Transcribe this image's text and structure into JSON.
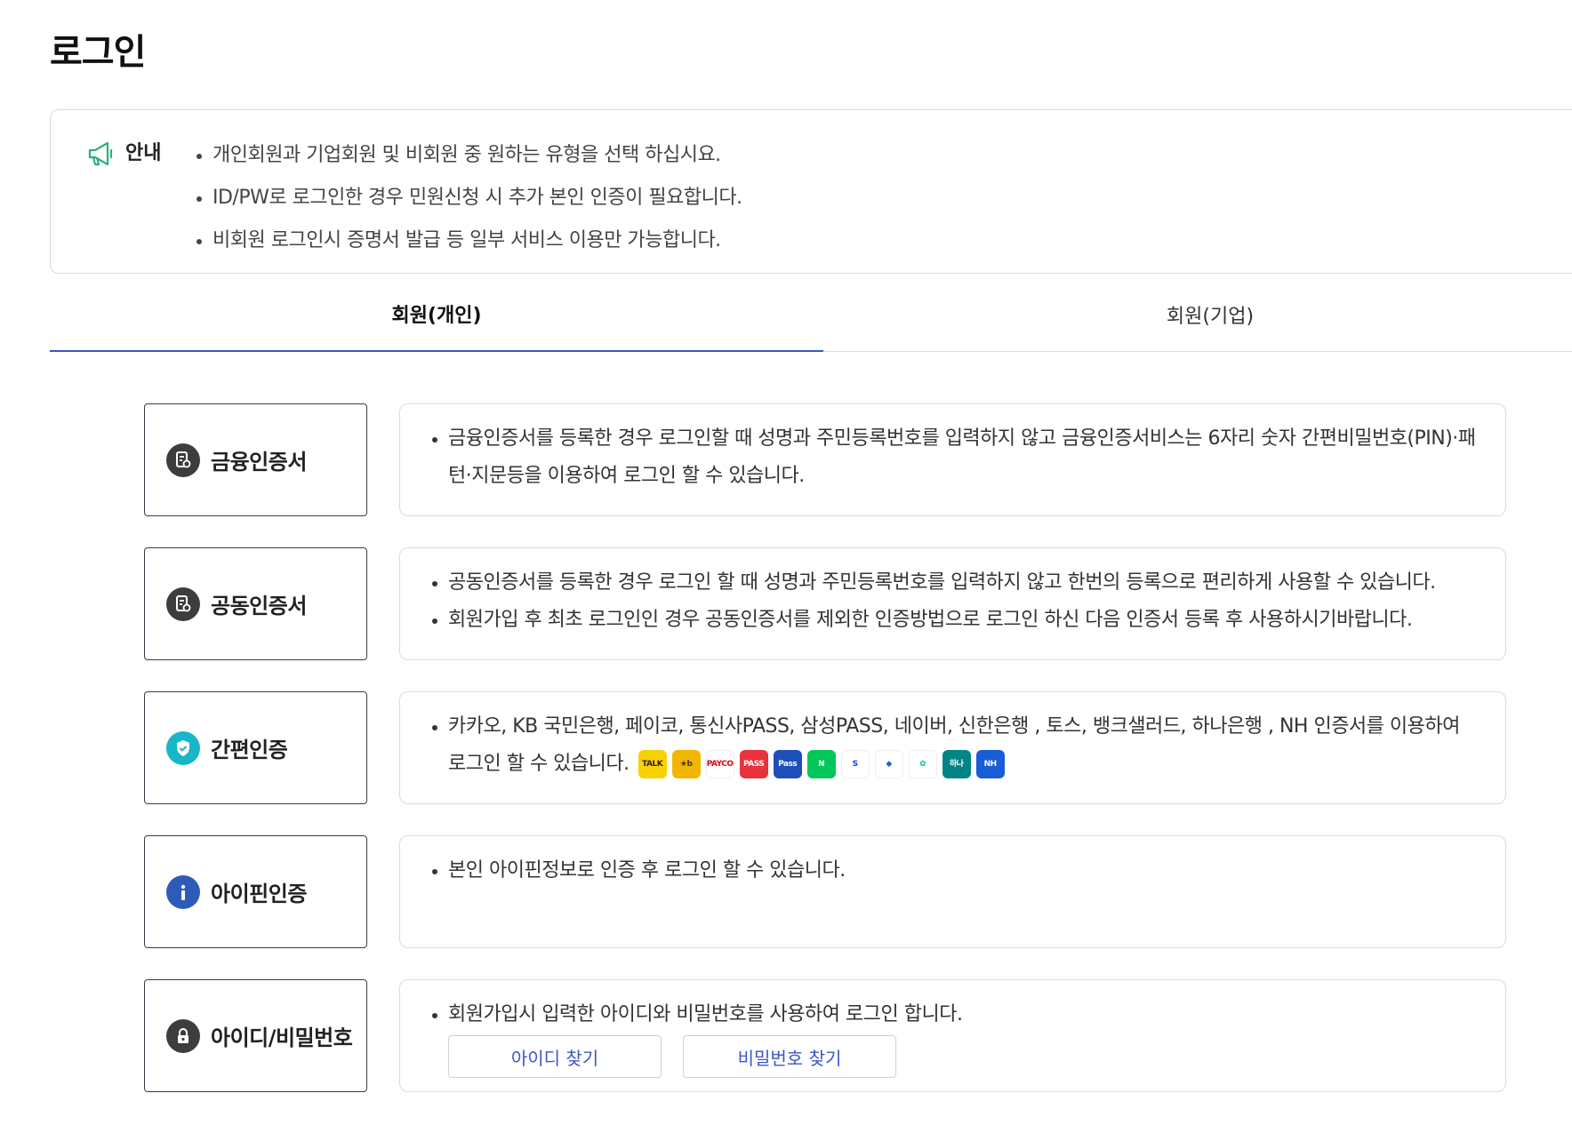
{
  "page": {
    "title": "로그인"
  },
  "notice": {
    "label": "안내",
    "items": [
      "개인회원과 기업회원 및 비회원 중 원하는 유형을 선택 하십시요.",
      "ID/PW로 로그인한 경우 민원신청 시 추가 본인 인증이 필요합니다.",
      "비회원 로그인시 증명서 발급 등 일부 서비스 이용만 가능합니다."
    ]
  },
  "tabs": [
    {
      "label": "회원(개인)",
      "active": true
    },
    {
      "label": "회원(기업)",
      "active": false
    }
  ],
  "methods": [
    {
      "label": "금융인증서",
      "icon": "certificate-icon",
      "desc": [
        "금융인증서를 등록한 경우 로그인할 때 성명과 주민등록번호를 입력하지 않고 금융인증서비스는 6자리 숫자 간편비밀번호(PIN)·패턴·지문등을 이용하여 로그인 할 수 있습니다."
      ]
    },
    {
      "label": "공동인증서",
      "icon": "certificate-icon",
      "desc": [
        "공동인증서를 등록한 경우 로그인 할 때 성명과 주민등록번호를 입력하지 않고 한번의 등록으로 편리하게 사용할 수 있습니다.",
        "회원가입 후 최초 로그인인 경우 공동인증서를 제외한 인증방법으로 로그인 하신 다음 인증서 등록 후 사용하시기바랍니다."
      ]
    },
    {
      "label": "간편인증",
      "icon": "shield-check-icon",
      "desc": [
        "카카오, KB 국민은행, 페이코, 통신사PASS, 삼성PASS, 네이버, 신한은행 , 토스, 뱅크샐러드, 하나은행 , NH 인증서를 이용하여 로그인 할 수 있습니다."
      ],
      "providers": [
        {
          "name": "kakao-logo",
          "text": "TALK",
          "bg": "#f7d200",
          "fg": "#3a1d1d"
        },
        {
          "name": "kb-logo",
          "text": "★b",
          "bg": "#f2b600",
          "fg": "#4a3b00"
        },
        {
          "name": "payco-logo",
          "text": "PAYCO",
          "bg": "#ffffff",
          "fg": "#e60012"
        },
        {
          "name": "pass-logo",
          "text": "PASS",
          "bg": "#e8323c",
          "fg": "#ffffff"
        },
        {
          "name": "samsung-pass-logo",
          "text": "Pass",
          "bg": "#1f4fb9",
          "fg": "#ffffff"
        },
        {
          "name": "naver-logo",
          "text": "N",
          "bg": "#03c75a",
          "fg": "#ffffff"
        },
        {
          "name": "shinhan-logo",
          "text": "S",
          "bg": "#ffffff",
          "fg": "#0046ff"
        },
        {
          "name": "toss-logo",
          "text": "◆",
          "bg": "#ffffff",
          "fg": "#1b64da"
        },
        {
          "name": "banksalad-logo",
          "text": "✿",
          "bg": "#ffffff",
          "fg": "#00c389"
        },
        {
          "name": "hana-logo",
          "text": "하나",
          "bg": "#008485",
          "fg": "#ffffff"
        },
        {
          "name": "nh-logo",
          "text": "NH",
          "bg": "#1a5bd6",
          "fg": "#ffffff"
        }
      ]
    },
    {
      "label": "아이핀인증",
      "icon": "info-icon",
      "desc": [
        "본인 아이핀정보로 인증 후 로그인 할 수 있습니다."
      ]
    },
    {
      "label": "아이디/비밀번호",
      "icon": "lock-icon",
      "desc": [
        "회원가입시 입력한 아이디와 비밀번호를 사용하여 로그인 합니다."
      ],
      "buttons": [
        "아이디 찾기",
        "비밀번호 찾기"
      ]
    }
  ]
}
